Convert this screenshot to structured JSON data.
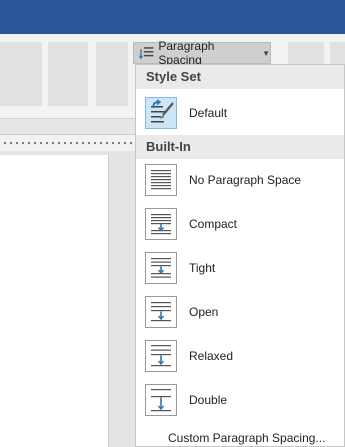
{
  "ribbon": {
    "paragraph_spacing_label": "Paragraph Spacing"
  },
  "dropdown": {
    "style_set_header": "Style Set",
    "default_label": "Default",
    "built_in_header": "Built-In",
    "items": [
      {
        "label": "No Paragraph Space"
      },
      {
        "label": "Compact"
      },
      {
        "label": "Tight"
      },
      {
        "label": "Open"
      },
      {
        "label": "Relaxed"
      },
      {
        "label": "Double"
      }
    ],
    "custom_label": "Custom Paragraph Spacing..."
  },
  "colors": {
    "titlebar": "#2b579a",
    "accent": "#2e75b6",
    "selected": "#cde6f7"
  }
}
